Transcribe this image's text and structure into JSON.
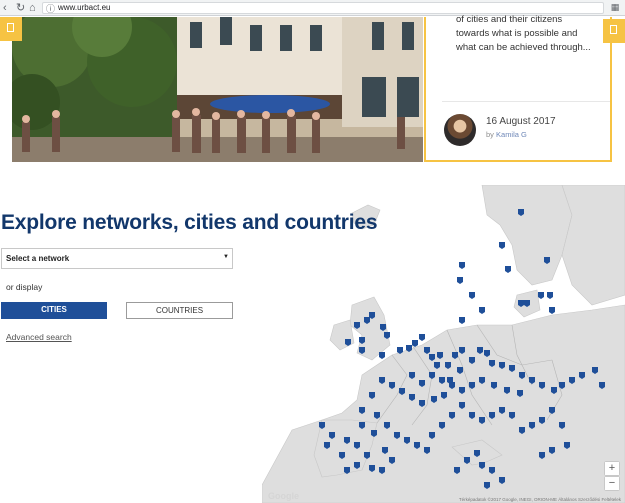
{
  "browser": {
    "url": "www.urbact.eu",
    "back_icon": "chevron-left-icon",
    "reload_icon": "reload-icon",
    "home_icon": "home-icon",
    "info_icon": "info-icon",
    "translate_icon": "translate-icon"
  },
  "article": {
    "teaser_lines": [
      "of cities and their citizens",
      "towards what is possible and",
      "what can be achieved through..."
    ],
    "date": "16 August 2017",
    "by_prefix": "by",
    "author": "Kamila G"
  },
  "explore": {
    "title": "Explore networks, cities and countries",
    "select_label": "Select a network",
    "or_display": "or display",
    "cities_label": "CITIES",
    "countries_label": "COUNTRIES",
    "advanced_search": "Advanced search"
  },
  "map": {
    "zoom_in": "+",
    "zoom_out": "−",
    "attribution": "Térképadatok ©2017 Google, INEGI, ORION-ME   Általános Szerződési Feltételek",
    "google_label": "Google",
    "land_color": "#dedede",
    "sea_color": "#ffffff",
    "marker_color": "#1f4f99",
    "accent_color": "#f6c343"
  }
}
